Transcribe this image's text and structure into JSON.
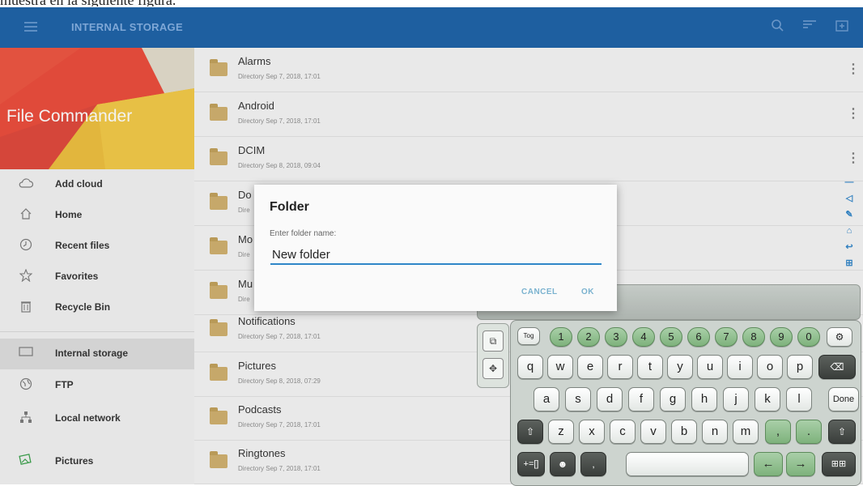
{
  "caption": "muestra en la siguiente figura.",
  "topbar": {
    "title": "INTERNAL STORAGE",
    "icons": [
      "menu-icon",
      "search-icon",
      "sort-icon",
      "new-folder-icon"
    ],
    "color": "#1e5fa0"
  },
  "sidebar": {
    "app_title": "File Commander",
    "items": [
      {
        "label": "Add cloud",
        "icon": "cloud-icon"
      },
      {
        "label": "Home",
        "icon": "home-icon"
      },
      {
        "label": "Recent files",
        "icon": "clock-icon"
      },
      {
        "label": "Favorites",
        "icon": "star-icon"
      },
      {
        "label": "Recycle Bin",
        "icon": "trash-icon"
      },
      {
        "label": "Internal storage",
        "icon": "tablet-icon"
      },
      {
        "label": "FTP",
        "icon": "globe-icon"
      },
      {
        "label": "Local network",
        "icon": "network-icon"
      },
      {
        "label": "Pictures",
        "icon": "pictures-icon"
      }
    ],
    "active": "Internal storage"
  },
  "files": [
    {
      "name": "Alarms",
      "meta": "Directory  Sep 7, 2018, 17:01"
    },
    {
      "name": "Android",
      "meta": "Directory  Sep 7, 2018, 17:01"
    },
    {
      "name": "DCIM",
      "meta": "Directory  Sep 8, 2018, 09:04"
    },
    {
      "name": "Do",
      "meta": "Dire"
    },
    {
      "name": "Mo",
      "meta": "Dire"
    },
    {
      "name": "Mu",
      "meta": "Dire"
    },
    {
      "name": "Notifications",
      "meta": "Directory  Sep 7, 2018, 17:01"
    },
    {
      "name": "Pictures",
      "meta": "Directory  Sep 8, 2018, 07:29"
    },
    {
      "name": "Podcasts",
      "meta": "Directory  Sep 7, 2018, 17:01"
    },
    {
      "name": "Ringtones",
      "meta": "Directory  Sep 7, 2018, 17:01"
    }
  ],
  "dialog": {
    "title": "Folder",
    "label": "Enter folder name:",
    "value": "New folder",
    "cancel": "CANCEL",
    "ok": "OK"
  },
  "keyboard": {
    "numbers": [
      "1",
      "2",
      "3",
      "4",
      "5",
      "6",
      "7",
      "8",
      "9",
      "0"
    ],
    "row1": [
      "q",
      "w",
      "e",
      "r",
      "t",
      "y",
      "u",
      "i",
      "o",
      "p"
    ],
    "row2": [
      "a",
      "s",
      "d",
      "f",
      "g",
      "h",
      "j",
      "k",
      "l"
    ],
    "row3": [
      "z",
      "x",
      "c",
      "v",
      "b",
      "n",
      "m"
    ],
    "done": "Done",
    "symbols": "+=[]",
    "comma": ","
  }
}
